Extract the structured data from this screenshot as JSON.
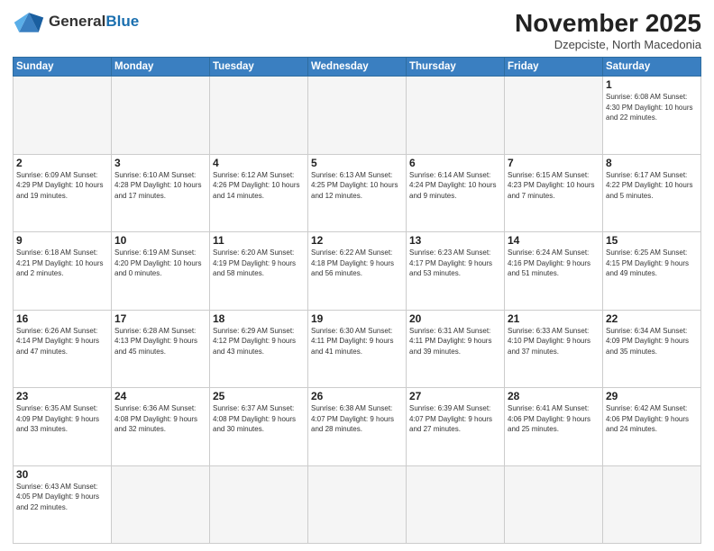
{
  "header": {
    "logo_general": "General",
    "logo_blue": "Blue",
    "title": "November 2025",
    "location": "Dzepciste, North Macedonia"
  },
  "weekdays": [
    "Sunday",
    "Monday",
    "Tuesday",
    "Wednesday",
    "Thursday",
    "Friday",
    "Saturday"
  ],
  "weeks": [
    [
      {
        "day": "",
        "info": ""
      },
      {
        "day": "",
        "info": ""
      },
      {
        "day": "",
        "info": ""
      },
      {
        "day": "",
        "info": ""
      },
      {
        "day": "",
        "info": ""
      },
      {
        "day": "",
        "info": ""
      },
      {
        "day": "1",
        "info": "Sunrise: 6:08 AM\nSunset: 4:30 PM\nDaylight: 10 hours\nand 22 minutes."
      }
    ],
    [
      {
        "day": "2",
        "info": "Sunrise: 6:09 AM\nSunset: 4:29 PM\nDaylight: 10 hours\nand 19 minutes."
      },
      {
        "day": "3",
        "info": "Sunrise: 6:10 AM\nSunset: 4:28 PM\nDaylight: 10 hours\nand 17 minutes."
      },
      {
        "day": "4",
        "info": "Sunrise: 6:12 AM\nSunset: 4:26 PM\nDaylight: 10 hours\nand 14 minutes."
      },
      {
        "day": "5",
        "info": "Sunrise: 6:13 AM\nSunset: 4:25 PM\nDaylight: 10 hours\nand 12 minutes."
      },
      {
        "day": "6",
        "info": "Sunrise: 6:14 AM\nSunset: 4:24 PM\nDaylight: 10 hours\nand 9 minutes."
      },
      {
        "day": "7",
        "info": "Sunrise: 6:15 AM\nSunset: 4:23 PM\nDaylight: 10 hours\nand 7 minutes."
      },
      {
        "day": "8",
        "info": "Sunrise: 6:17 AM\nSunset: 4:22 PM\nDaylight: 10 hours\nand 5 minutes."
      }
    ],
    [
      {
        "day": "9",
        "info": "Sunrise: 6:18 AM\nSunset: 4:21 PM\nDaylight: 10 hours\nand 2 minutes."
      },
      {
        "day": "10",
        "info": "Sunrise: 6:19 AM\nSunset: 4:20 PM\nDaylight: 10 hours\nand 0 minutes."
      },
      {
        "day": "11",
        "info": "Sunrise: 6:20 AM\nSunset: 4:19 PM\nDaylight: 9 hours\nand 58 minutes."
      },
      {
        "day": "12",
        "info": "Sunrise: 6:22 AM\nSunset: 4:18 PM\nDaylight: 9 hours\nand 56 minutes."
      },
      {
        "day": "13",
        "info": "Sunrise: 6:23 AM\nSunset: 4:17 PM\nDaylight: 9 hours\nand 53 minutes."
      },
      {
        "day": "14",
        "info": "Sunrise: 6:24 AM\nSunset: 4:16 PM\nDaylight: 9 hours\nand 51 minutes."
      },
      {
        "day": "15",
        "info": "Sunrise: 6:25 AM\nSunset: 4:15 PM\nDaylight: 9 hours\nand 49 minutes."
      }
    ],
    [
      {
        "day": "16",
        "info": "Sunrise: 6:26 AM\nSunset: 4:14 PM\nDaylight: 9 hours\nand 47 minutes."
      },
      {
        "day": "17",
        "info": "Sunrise: 6:28 AM\nSunset: 4:13 PM\nDaylight: 9 hours\nand 45 minutes."
      },
      {
        "day": "18",
        "info": "Sunrise: 6:29 AM\nSunset: 4:12 PM\nDaylight: 9 hours\nand 43 minutes."
      },
      {
        "day": "19",
        "info": "Sunrise: 6:30 AM\nSunset: 4:11 PM\nDaylight: 9 hours\nand 41 minutes."
      },
      {
        "day": "20",
        "info": "Sunrise: 6:31 AM\nSunset: 4:11 PM\nDaylight: 9 hours\nand 39 minutes."
      },
      {
        "day": "21",
        "info": "Sunrise: 6:33 AM\nSunset: 4:10 PM\nDaylight: 9 hours\nand 37 minutes."
      },
      {
        "day": "22",
        "info": "Sunrise: 6:34 AM\nSunset: 4:09 PM\nDaylight: 9 hours\nand 35 minutes."
      }
    ],
    [
      {
        "day": "23",
        "info": "Sunrise: 6:35 AM\nSunset: 4:09 PM\nDaylight: 9 hours\nand 33 minutes."
      },
      {
        "day": "24",
        "info": "Sunrise: 6:36 AM\nSunset: 4:08 PM\nDaylight: 9 hours\nand 32 minutes."
      },
      {
        "day": "25",
        "info": "Sunrise: 6:37 AM\nSunset: 4:08 PM\nDaylight: 9 hours\nand 30 minutes."
      },
      {
        "day": "26",
        "info": "Sunrise: 6:38 AM\nSunset: 4:07 PM\nDaylight: 9 hours\nand 28 minutes."
      },
      {
        "day": "27",
        "info": "Sunrise: 6:39 AM\nSunset: 4:07 PM\nDaylight: 9 hours\nand 27 minutes."
      },
      {
        "day": "28",
        "info": "Sunrise: 6:41 AM\nSunset: 4:06 PM\nDaylight: 9 hours\nand 25 minutes."
      },
      {
        "day": "29",
        "info": "Sunrise: 6:42 AM\nSunset: 4:06 PM\nDaylight: 9 hours\nand 24 minutes."
      }
    ],
    [
      {
        "day": "30",
        "info": "Sunrise: 6:43 AM\nSunset: 4:05 PM\nDaylight: 9 hours\nand 22 minutes."
      },
      {
        "day": "",
        "info": ""
      },
      {
        "day": "",
        "info": ""
      },
      {
        "day": "",
        "info": ""
      },
      {
        "day": "",
        "info": ""
      },
      {
        "day": "",
        "info": ""
      },
      {
        "day": "",
        "info": ""
      }
    ]
  ]
}
